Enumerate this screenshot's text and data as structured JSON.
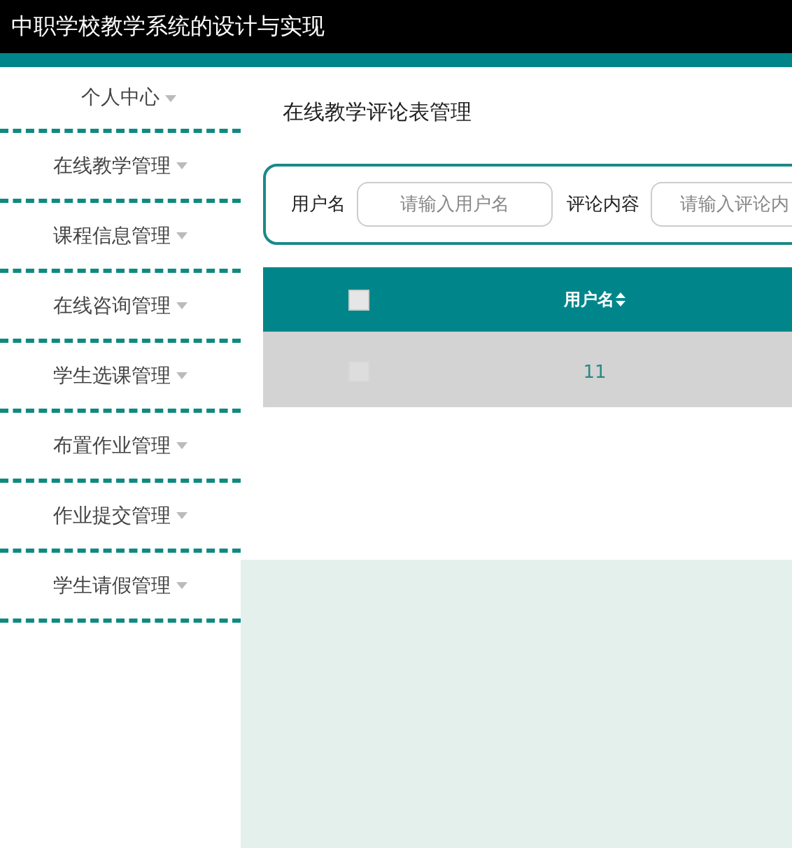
{
  "header": {
    "title": "中职学校教学系统的设计与实现"
  },
  "sidebar": {
    "items": [
      {
        "label": "个人中心",
        "expanded": false
      },
      {
        "label": "在线教学管理",
        "expanded": false
      },
      {
        "label": "课程信息管理",
        "expanded": false
      },
      {
        "label": "在线咨询管理",
        "expanded": false
      },
      {
        "label": "学生选课管理",
        "expanded": false
      },
      {
        "label": "布置作业管理",
        "expanded": false
      },
      {
        "label": "作业提交管理",
        "expanded": false
      },
      {
        "label": "学生请假管理",
        "expanded": false
      }
    ]
  },
  "page_title": "在线教学评论表管理",
  "search": {
    "fields": [
      {
        "label": "用户名",
        "placeholder": "请输入用户名"
      },
      {
        "label": "评论内容",
        "placeholder": "请输入评论内"
      }
    ]
  },
  "table": {
    "select_all": {
      "checked": false
    },
    "columns": [
      {
        "label": "用户名",
        "sortable": true
      }
    ],
    "rows": [
      {
        "selected": false,
        "cells": [
          "11"
        ]
      }
    ]
  }
}
